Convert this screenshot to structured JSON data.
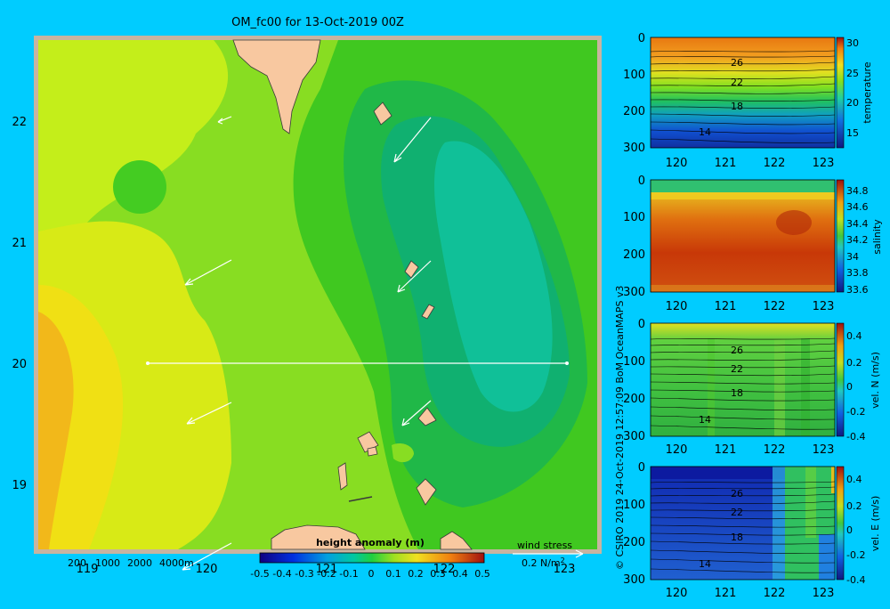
{
  "page": {
    "background": "#00ccff"
  },
  "main_map": {
    "title": "OM_fc00 for 13-Oct-2019 00Z",
    "x_ticks": [
      "119",
      "120",
      "121",
      "122",
      "123"
    ],
    "y_ticks": [
      "22",
      "21",
      "20",
      "19"
    ],
    "depth_labels": [
      "200",
      "1000",
      "2000",
      "4000m"
    ],
    "colorbar_title": "height anomaly  (m)",
    "colorbar_ticks": [
      "-0.5",
      "-0.4",
      "-0.3",
      "-0.2",
      "-0.1",
      "0",
      "0.1",
      "0.2",
      "0.3",
      "0.4",
      "0.5"
    ],
    "wind_label": "wind stress",
    "wind_scale": "0.2 N/m",
    "wind_scale_sup": "2"
  },
  "credit": "© CSIRO 2019   24-Oct-2019 12:57:09 BoM OceanMAPS v3",
  "chart_data": [
    {
      "type": "heatmap",
      "title": "OM_fc00 for 13-Oct-2019 00Z",
      "x_range": [
        118.5,
        123.5
      ],
      "y_range": [
        18.3,
        22.7
      ],
      "field": "height anomaly (m)",
      "value_range": [
        -0.5,
        0.5
      ],
      "section_line": {
        "from": [
          119.5,
          20.0
        ],
        "to": [
          123.2,
          20.0
        ]
      }
    },
    {
      "type": "heatmap",
      "colorbar_label": "temperature",
      "colorbar_ticks": [
        "30",
        "25",
        "20",
        "15"
      ],
      "contour_labels": [
        "26",
        "22",
        "18",
        "14"
      ],
      "x_ticks": [
        "120",
        "121",
        "122",
        "123"
      ],
      "y_ticks": [
        "0",
        "100",
        "200",
        "300"
      ]
    },
    {
      "type": "heatmap",
      "colorbar_label": "salinity",
      "colorbar_ticks": [
        "34.8",
        "34.6",
        "34.4",
        "34.2",
        "34",
        "33.8",
        "33.6"
      ],
      "x_ticks": [
        "120",
        "121",
        "122",
        "123"
      ],
      "y_ticks": [
        "0",
        "100",
        "200",
        "300"
      ]
    },
    {
      "type": "heatmap",
      "colorbar_label": "vel. N (m/s)",
      "colorbar_ticks": [
        "0.4",
        "0.2",
        "0",
        "-0.2",
        "-0.4"
      ],
      "contour_labels": [
        "26",
        "22",
        "18",
        "14"
      ],
      "x_ticks": [
        "120",
        "121",
        "122",
        "123"
      ],
      "y_ticks": [
        "0",
        "100",
        "200",
        "300"
      ]
    },
    {
      "type": "heatmap",
      "colorbar_label": "vel. E (m/s)",
      "colorbar_ticks": [
        "0.4",
        "0.2",
        "0",
        "-0.2",
        "-0.4"
      ],
      "contour_labels": [
        "26",
        "22",
        "18",
        "14"
      ],
      "x_ticks": [
        "120",
        "121",
        "122",
        "123"
      ],
      "y_ticks": [
        "0",
        "100",
        "200",
        "300"
      ]
    }
  ]
}
